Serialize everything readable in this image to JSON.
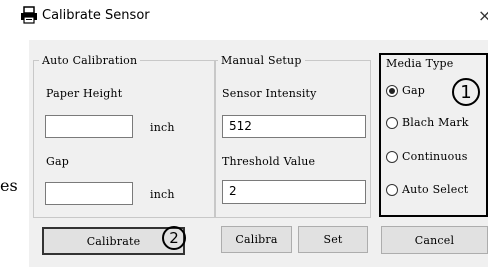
{
  "window": {
    "title": "Calibrate Sensor",
    "close_glyph": "×",
    "edge_text": "es"
  },
  "auto_calibration": {
    "legend": "Auto Calibration",
    "paper_height_label": "Paper Height",
    "paper_height_value": "",
    "paper_height_unit": "inch",
    "gap_label": "Gap",
    "gap_value": "",
    "gap_unit": "inch",
    "calibrate_button": "Calibrate",
    "marker": "2"
  },
  "manual_setup": {
    "legend": "Manual Setup",
    "sensor_intensity_label": "Sensor Intensity",
    "sensor_intensity_value": "512",
    "threshold_label": "Threshold Value",
    "threshold_value": "2",
    "calibra_button": "Calibra",
    "set_button": "Set"
  },
  "media_type": {
    "legend": "Media Type",
    "marker": "1",
    "options": [
      {
        "label": "Gap",
        "checked": true
      },
      {
        "label": "Blach Mark",
        "checked": false
      },
      {
        "label": "Continuous",
        "checked": false
      },
      {
        "label": "Auto Select",
        "checked": false
      }
    ],
    "cancel_button": "Cancel"
  },
  "icons": {
    "app_icon": "printer-icon"
  }
}
